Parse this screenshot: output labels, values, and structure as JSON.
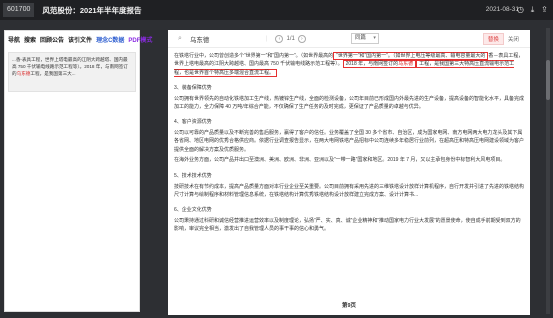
{
  "topbar": {
    "code": "601700",
    "title": "风范股份：2021年半年度报告",
    "date": "2021-08-31",
    "icons": [
      "clock-icon",
      "download-icon",
      "share-icon"
    ]
  },
  "left_panel": {
    "tabs": [
      "导航",
      "搜索",
      "回顾公告",
      "该引文件",
      "理念C数据",
      "PDF模式"
    ],
    "snippet_pre": "...香-表具工程，世界上塔电最高的江阴大跨越塔、国内最高 750 千伏输电线路示范工程等）。2018 年，与南网签订的",
    "snippet_hl": "乌东德",
    "snippet_post": "工程，是我国第三大..."
  },
  "doc": {
    "search_value": "乌东德",
    "match_counter": "1/1",
    "match_mode": "同篇",
    "replace_label": "替换",
    "close_label": "关闭",
    "paragraphs": {
      "p1a": "在铁塔行业中，公司曾创造多个“世界第一”和“国内第一”。（如世界最高的",
      "p1b": "“世界第一”和“国内第一”。（如世界上电压等级最高、输电容量最大的",
      "p1c": "香－表具工程，世界上塔电最高的江阴大跨越塔、国内最高 750 千伏输电线路示范工程等）。",
      "p1d": "2018 年，与南网签订的",
      "p1e_hl": "乌东德",
      "p1f": "工程，是我国第三大特高压直流输电示范工程，也是世界首个特高压多端混合直流工程。",
      "s3": "3、装备保障优势",
      "p3": "公司拥有世界领先的自动化铁塔加工生产线，热镀锌生产线，全面的检测设备，公司年目前已形成国内外最先进的生产设备，提高设备的智能化水平，具备完成加工的能力，全力保障 40 万吨/年综合产能，不仅确保了生产任务的及时完成，更保证了产品质量的卓越与优异。",
      "s4": "4、客户资源优势",
      "p4": "公司以可靠的产品质量以及不断完善的售后服务，赢得了客户的信任。业务覆盖了全国 30 多个省市、自治区，成为国家电网、南方电网两大电力龙头及其下属各省网、地区电网的优秀合格供应商。依据行业调查报告显示，在两大电网铁塔产品招标中公司连续多年稳居行业前列，在超高压和特高压电网建设领域为客户提供全面的解决方案及优质服务。",
      "p4b": "在海外业务方面，公司产品并出口至澳洲、美洲、欧洲、非洲、亚洲以及“一带一路”国家和地区。2019 年 7 月，又以主承包身份中标智利大风电项目。",
      "s5": "5、技术技术优势",
      "p5": "技研技术在有节约成本，提高产品质量方面对本行业企业至关重要。公司目前拥有采用先进的三维铁塔设计放样计算机程序，自行开发并引进了先进的铁塔结构尺寸计算与绘制程序和材料管理信息系统，在铁塔结构计算优秀铁塔结构设计放样建立完成方案、设计计算书...",
      "s6": "6、企业文化优势",
      "p6": "公司秉持通过科研和诚信经营推进运营效率以及制度理论，弘扬“严、实、真、诚”企业精神和“推动国家电力行业大发展”的愿景使命，使自成手前期受到双方的影响，审议完全相当，激发出了自我管理人员的事干事的信心和勇气。"
    },
    "page_label": "第9页"
  }
}
